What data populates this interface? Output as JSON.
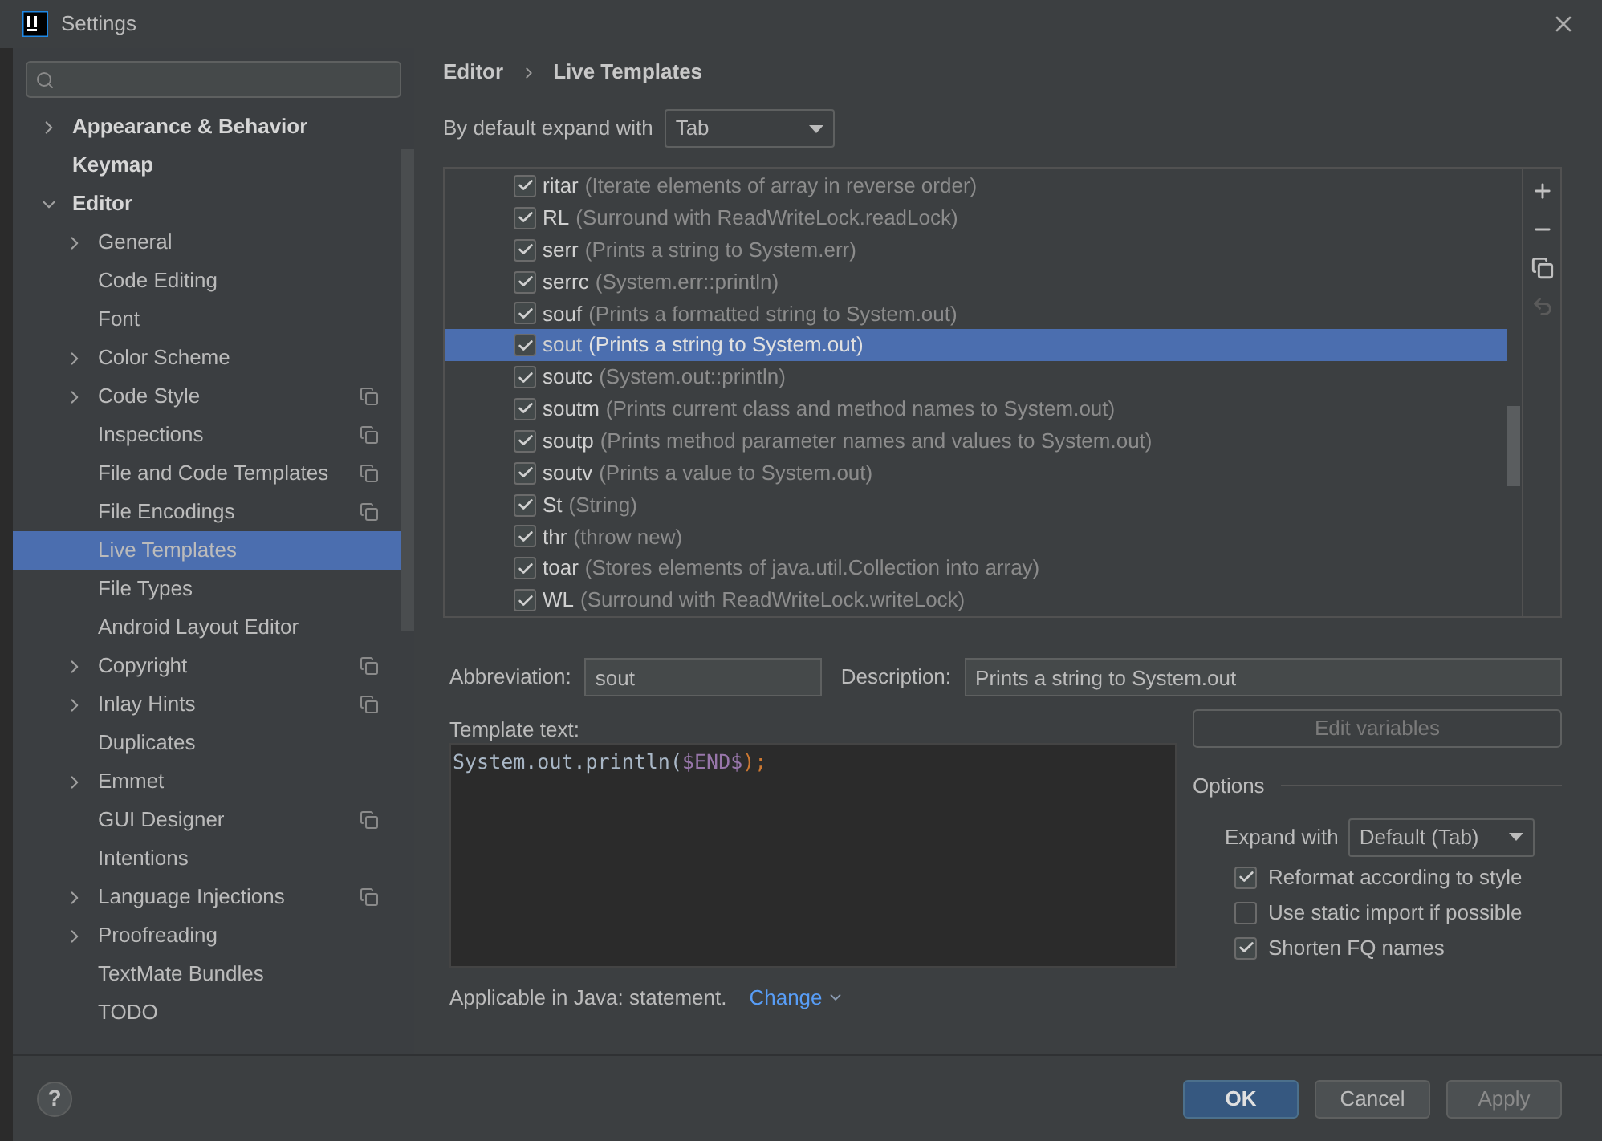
{
  "window": {
    "title": "Settings"
  },
  "help": {
    "label": "?"
  },
  "sidebar": {
    "items": [
      {
        "label": "Appearance & Behavior",
        "bold": true,
        "expanded": false,
        "selected": false,
        "has_children": true,
        "shared": false
      },
      {
        "label": "Keymap",
        "bold": true,
        "expanded": false,
        "selected": false,
        "has_children": false,
        "shared": false
      },
      {
        "label": "Editor",
        "bold": true,
        "expanded": true,
        "selected": false,
        "has_children": true,
        "shared": false,
        "children": [
          {
            "label": "General",
            "expanded": false,
            "selected": false,
            "has_children": true,
            "shared": false
          },
          {
            "label": "Code Editing",
            "expanded": false,
            "selected": false,
            "has_children": false,
            "shared": false
          },
          {
            "label": "Font",
            "expanded": false,
            "selected": false,
            "has_children": false,
            "shared": false
          },
          {
            "label": "Color Scheme",
            "expanded": false,
            "selected": false,
            "has_children": true,
            "shared": false
          },
          {
            "label": "Code Style",
            "expanded": false,
            "selected": false,
            "has_children": true,
            "shared": true
          },
          {
            "label": "Inspections",
            "expanded": false,
            "selected": false,
            "has_children": false,
            "shared": true
          },
          {
            "label": "File and Code Templates",
            "expanded": false,
            "selected": false,
            "has_children": false,
            "shared": true
          },
          {
            "label": "File Encodings",
            "expanded": false,
            "selected": false,
            "has_children": false,
            "shared": true
          },
          {
            "label": "Live Templates",
            "expanded": false,
            "selected": true,
            "has_children": false,
            "shared": false
          },
          {
            "label": "File Types",
            "expanded": false,
            "selected": false,
            "has_children": false,
            "shared": false
          },
          {
            "label": "Android Layout Editor",
            "expanded": false,
            "selected": false,
            "has_children": false,
            "shared": false
          },
          {
            "label": "Copyright",
            "expanded": false,
            "selected": false,
            "has_children": true,
            "shared": true
          },
          {
            "label": "Inlay Hints",
            "expanded": false,
            "selected": false,
            "has_children": true,
            "shared": true
          },
          {
            "label": "Duplicates",
            "expanded": false,
            "selected": false,
            "has_children": false,
            "shared": false
          },
          {
            "label": "Emmet",
            "expanded": false,
            "selected": false,
            "has_children": true,
            "shared": false
          },
          {
            "label": "GUI Designer",
            "expanded": false,
            "selected": false,
            "has_children": false,
            "shared": true
          },
          {
            "label": "Intentions",
            "expanded": false,
            "selected": false,
            "has_children": false,
            "shared": false
          },
          {
            "label": "Language Injections",
            "expanded": false,
            "selected": false,
            "has_children": true,
            "shared": true
          },
          {
            "label": "Proofreading",
            "expanded": false,
            "selected": false,
            "has_children": true,
            "shared": false
          },
          {
            "label": "TextMate Bundles",
            "expanded": false,
            "selected": false,
            "has_children": false,
            "shared": false
          },
          {
            "label": "TODO",
            "expanded": false,
            "selected": false,
            "has_children": false,
            "shared": false
          }
        ]
      }
    ]
  },
  "breadcrumb": [
    "Editor",
    "Live Templates"
  ],
  "expand_default": {
    "label": "By default expand with",
    "value": "Tab"
  },
  "templates": [
    {
      "abbr": "ritar",
      "desc": "(Iterate elements of array in reverse order)",
      "checked": true,
      "selected": false
    },
    {
      "abbr": "RL",
      "desc": "(Surround with ReadWriteLock.readLock)",
      "checked": true,
      "selected": false
    },
    {
      "abbr": "serr",
      "desc": "(Prints a string to System.err)",
      "checked": true,
      "selected": false
    },
    {
      "abbr": "serrc",
      "desc": "(System.err::println)",
      "checked": true,
      "selected": false
    },
    {
      "abbr": "souf",
      "desc": "(Prints a formatted string to System.out)",
      "checked": true,
      "selected": false
    },
    {
      "abbr": "sout",
      "desc": "(Prints a string to System.out)",
      "checked": true,
      "selected": true
    },
    {
      "abbr": "soutc",
      "desc": "(System.out::println)",
      "checked": true,
      "selected": false
    },
    {
      "abbr": "soutm",
      "desc": "(Prints current class and method names to System.out)",
      "checked": true,
      "selected": false
    },
    {
      "abbr": "soutp",
      "desc": "(Prints method parameter names and values to System.out)",
      "checked": true,
      "selected": false
    },
    {
      "abbr": "soutv",
      "desc": "(Prints a value to System.out)",
      "checked": true,
      "selected": false
    },
    {
      "abbr": "St",
      "desc": "(String)",
      "checked": true,
      "selected": false
    },
    {
      "abbr": "thr",
      "desc": "(throw new)",
      "checked": true,
      "selected": false
    },
    {
      "abbr": "toar",
      "desc": "(Stores elements of java.util.Collection into array)",
      "checked": true,
      "selected": false
    },
    {
      "abbr": "WL",
      "desc": "(Surround with ReadWriteLock.writeLock)",
      "checked": true,
      "selected": false
    }
  ],
  "toolbar": [
    {
      "kind": "add",
      "disabled": false
    },
    {
      "kind": "remove",
      "disabled": false
    },
    {
      "kind": "copy",
      "disabled": false
    },
    {
      "kind": "restore",
      "disabled": true
    }
  ],
  "abbreviation": {
    "label": "Abbreviation:",
    "value": "sout"
  },
  "description": {
    "label": "Description:",
    "value": "Prints a string to System.out"
  },
  "template_text": {
    "label": "Template text:",
    "segments": [
      {
        "kind": "plain",
        "text": "System.out.println("
      },
      {
        "kind": "variable",
        "text": "$END$"
      },
      {
        "kind": "punct",
        "text": ");"
      }
    ]
  },
  "edit_variables": {
    "label": "Edit variables",
    "disabled": true
  },
  "options": {
    "title": "Options",
    "expand_label": "Expand with",
    "expand_value": "Default (Tab)",
    "checkboxes": [
      {
        "label": "Reformat according to style",
        "checked": true
      },
      {
        "label": "Use static import if possible",
        "checked": false
      },
      {
        "label": "Shorten FQ names",
        "checked": true
      }
    ]
  },
  "applicable": {
    "text": "Applicable in Java: statement.",
    "link": "Change"
  },
  "buttons": [
    {
      "label": "OK",
      "kind": "primary",
      "disabled": false
    },
    {
      "label": "Cancel",
      "kind": "normal",
      "disabled": false
    },
    {
      "label": "Apply",
      "kind": "normal",
      "disabled": true
    }
  ]
}
